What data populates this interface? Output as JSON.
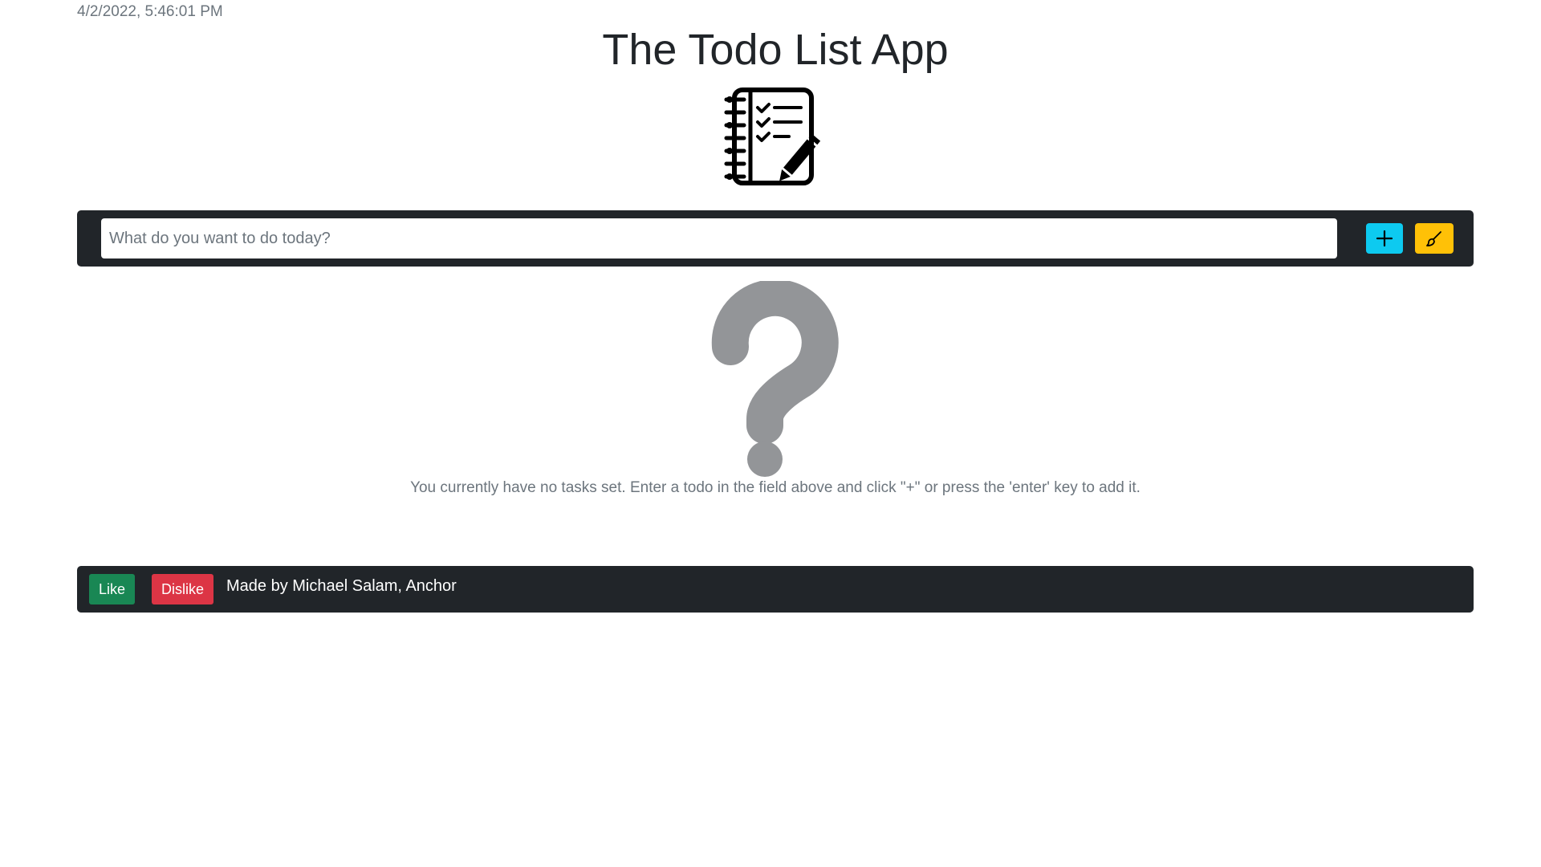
{
  "header": {
    "datetime": "4/2/2022, 5:46:01 PM",
    "title": "The Todo List App",
    "logo_icon": "notebook-checklist-pencil-icon"
  },
  "todo_form": {
    "input_value": "",
    "input_placeholder": "What do you want to do today?",
    "add_icon": "plus-icon",
    "clear_icon": "brush-icon",
    "colors": {
      "bar": "#212529",
      "add_button": "#0dcaf0",
      "clear_button": "#ffc107"
    }
  },
  "empty_state": {
    "icon": "question-mark-icon",
    "message": "You currently have no tasks set. Enter a todo in the field above and click \"+\" or press the 'enter' key to add it."
  },
  "footer": {
    "like_label": "Like",
    "dislike_label": "Dislike",
    "credit": "Made by Michael Salam, Anchor",
    "colors": {
      "like": "#198754",
      "dislike": "#dc3545"
    }
  }
}
